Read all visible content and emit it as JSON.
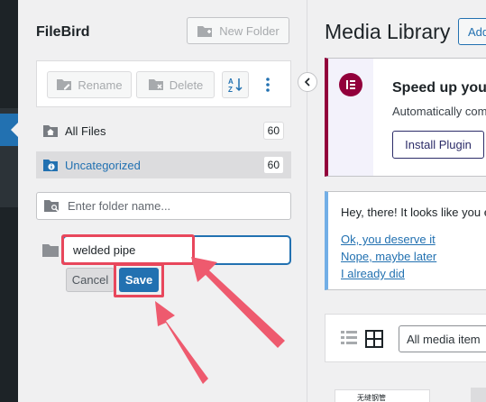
{
  "filebird": {
    "title": "FileBird",
    "new_folder_label": "New Folder",
    "toolbar": {
      "rename_label": "Rename",
      "delete_label": "Delete"
    },
    "folders": [
      {
        "label": "All Files",
        "count": "60"
      },
      {
        "label": "Uncategorized",
        "count": "60"
      }
    ],
    "search_placeholder": "Enter folder name...",
    "new_folder_input_value": "welded pipe",
    "cancel_label": "Cancel",
    "save_label": "Save"
  },
  "main": {
    "title": "Media Library",
    "add_label": "Add",
    "elementor_notice": {
      "heading": "Speed up you",
      "description": "Automatically com",
      "install_label": "Install Plugin"
    },
    "review_notice": {
      "message": "Hey, there! It looks like you e",
      "links": [
        "Ok, you deserve it",
        "Nope, maybe later",
        "I already did"
      ]
    },
    "filter_label": "All media item",
    "thumbnail_caption": "无缝钢管"
  },
  "colors": {
    "accent": "#2271b1",
    "highlight": "#e8475c",
    "elementor": "#92003b"
  },
  "icons": [
    "new-folder-icon",
    "rename-icon",
    "delete-icon",
    "sort-icon",
    "more-icon",
    "home-folder-icon",
    "info-folder-icon",
    "search-folder-icon",
    "folder-icon",
    "chevron-left-icon",
    "elementor-logo-icon",
    "list-view-icon",
    "grid-view-icon"
  ]
}
